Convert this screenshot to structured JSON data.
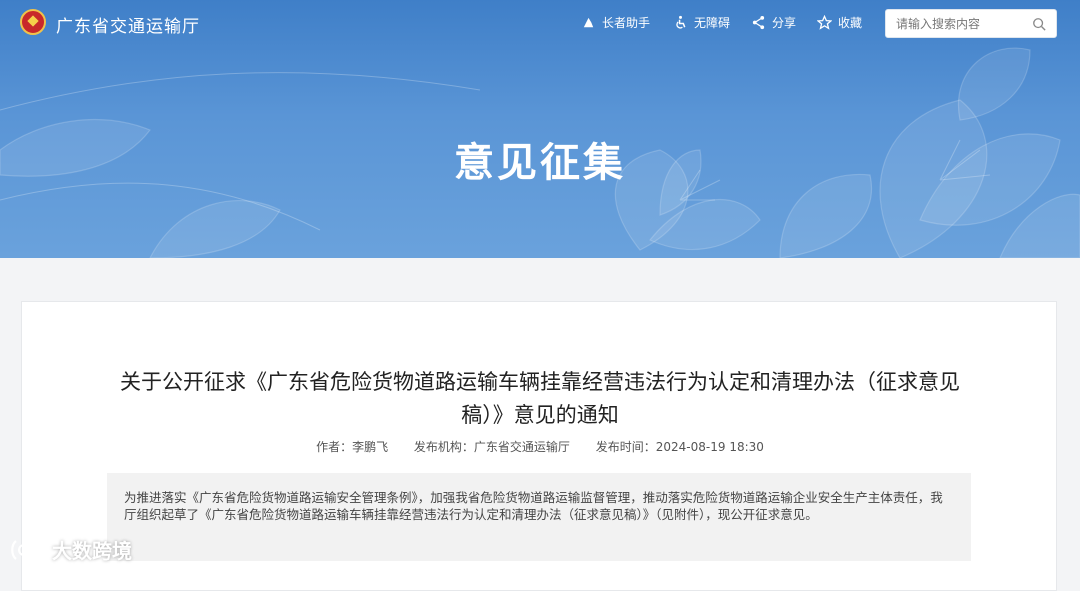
{
  "header": {
    "site_title": "广东省交通运输厅",
    "nav": [
      {
        "label": "长者助手",
        "icon": "elder-helper-icon"
      },
      {
        "label": "无障碍",
        "icon": "accessibility-icon"
      },
      {
        "label": "分享",
        "icon": "share-icon"
      },
      {
        "label": "收藏",
        "icon": "star-icon"
      }
    ],
    "search_placeholder": "请输入搜索内容"
  },
  "banner": {
    "title": "意见征集"
  },
  "article": {
    "title_line1": "关于公开征求《广东省危险货物道路运输车辆挂靠经营违法行为认定和清理办法（征求意见",
    "title_line2": "稿）》意见的通知",
    "author": "作者：李鹏飞",
    "publisher": "发布机构：广东省交通运输厅",
    "publish_time": "发布时间：2024-08-19 18:30",
    "summary": "为推进落实《广东省危险货物道路运输安全管理条例》，加强我省危险货物道路运输监督管理，推动落实危险货物道路运输企业安全生产主体责任，我厅组织起草了《广东省危险货物道路运输车辆挂靠经营违法行为认定和清理办法（征求意见稿）》（见附件），现公开征求意见。"
  },
  "watermark": {
    "text": "大数跨境"
  },
  "colors": {
    "banner_blue": "#4f8bd0",
    "card_bg": "#ffffff",
    "summary_bg": "#f2f2f2"
  }
}
